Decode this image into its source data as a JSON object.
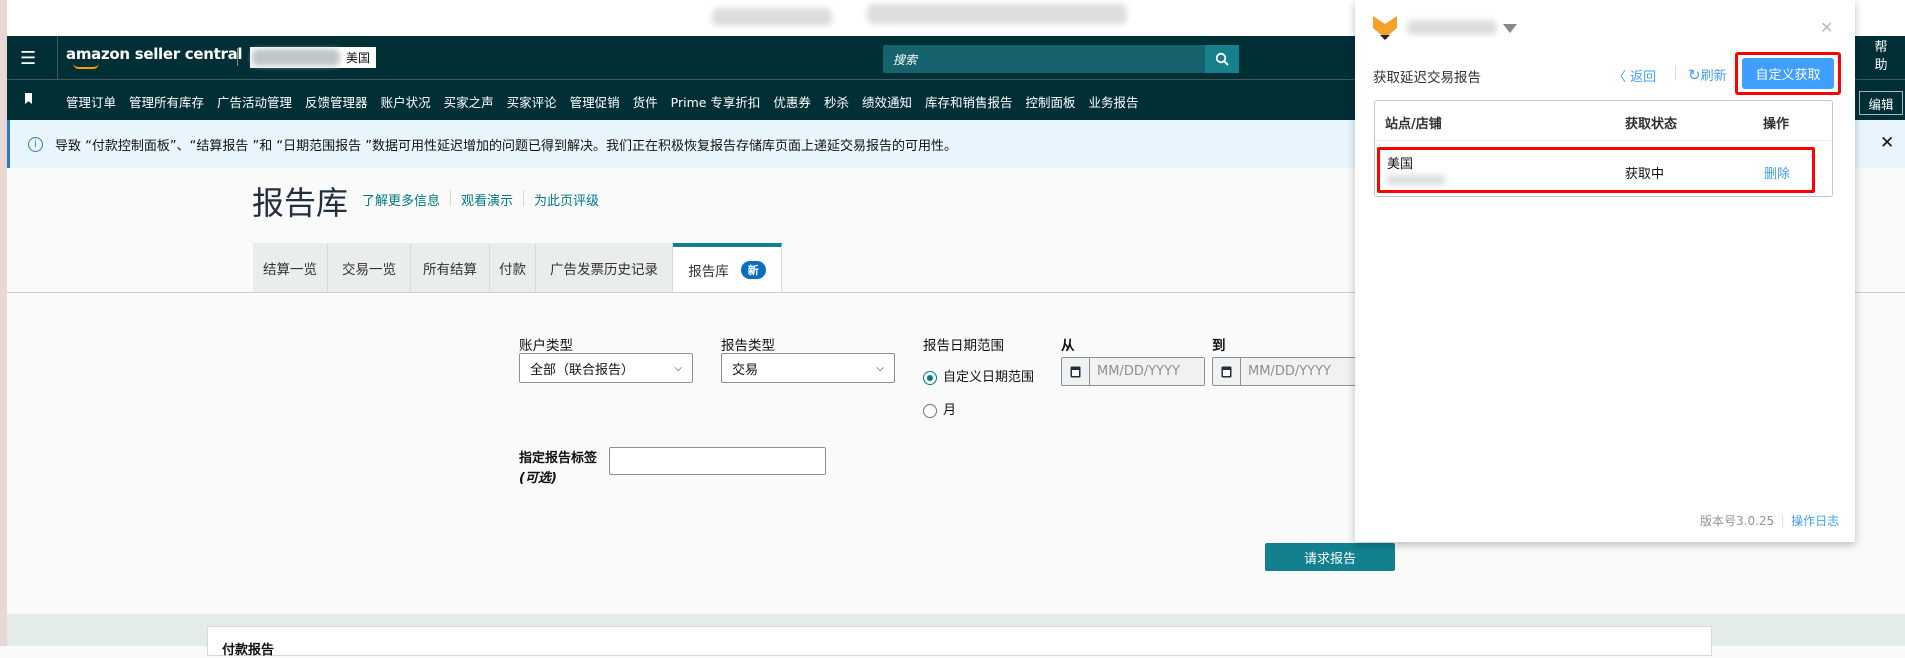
{
  "header": {
    "logo": "amazon seller central",
    "marketplace": "美国",
    "search_placeholder": "搜索",
    "help": "帮助",
    "edit": "编辑"
  },
  "nav": [
    "管理订单",
    "管理所有库存",
    "广告活动管理",
    "反馈管理器",
    "账户状况",
    "买家之声",
    "买家评论",
    "管理促销",
    "货件",
    "Prime 专享折扣",
    "优惠券",
    "秒杀",
    "绩效通知",
    "库存和销售报告",
    "控制面板",
    "业务报告"
  ],
  "banner": {
    "text": "导致 “付款控制面板”、“结算报告 ”和 “日期范围报告 ”数据可用性延迟增加的问题已得到解决。我们正在积极恢复报告存储库页面上递延交易报告的可用性。"
  },
  "page": {
    "title": "报告库",
    "links": [
      "了解更多信息",
      "观看演示",
      "为此页评级"
    ]
  },
  "tabs": [
    {
      "label": "结算一览"
    },
    {
      "label": "交易一览"
    },
    {
      "label": "所有结算"
    },
    {
      "label": "付款"
    },
    {
      "label": "广告发票历史记录"
    },
    {
      "label": "报告库",
      "badge": "新",
      "active": true
    }
  ],
  "form": {
    "account_type_label": "账户类型",
    "account_type_value": "全部（联合报告）",
    "report_type_label": "报告类型",
    "report_type_value": "交易",
    "date_range_label": "报告日期范围",
    "radio_custom": "自定义日期范围",
    "radio_month": "月",
    "from_label": "从",
    "to_label": "到",
    "date_placeholder": "MM/DD/YYYY",
    "tag_label": "指定报告标签",
    "tag_optional": "(可选)",
    "tag_value": "",
    "submit": "请求报告"
  },
  "bottom": {
    "card_title": "付款报告"
  },
  "panel": {
    "title": "获取延迟交易报告",
    "back": "返回",
    "refresh": "刷新",
    "custom_fetch": "自定义获取",
    "columns": [
      "站点/店铺",
      "获取状态",
      "操作"
    ],
    "rows": [
      {
        "site": "美国",
        "status": "获取中",
        "action": "删除"
      }
    ],
    "version": "版本号3.0.25",
    "log": "操作日志"
  },
  "colors": {
    "header": "#002f36",
    "accent": "#017884",
    "button": "#12808f",
    "panel_primary": "#409eff",
    "highlight": "#ff0000"
  }
}
